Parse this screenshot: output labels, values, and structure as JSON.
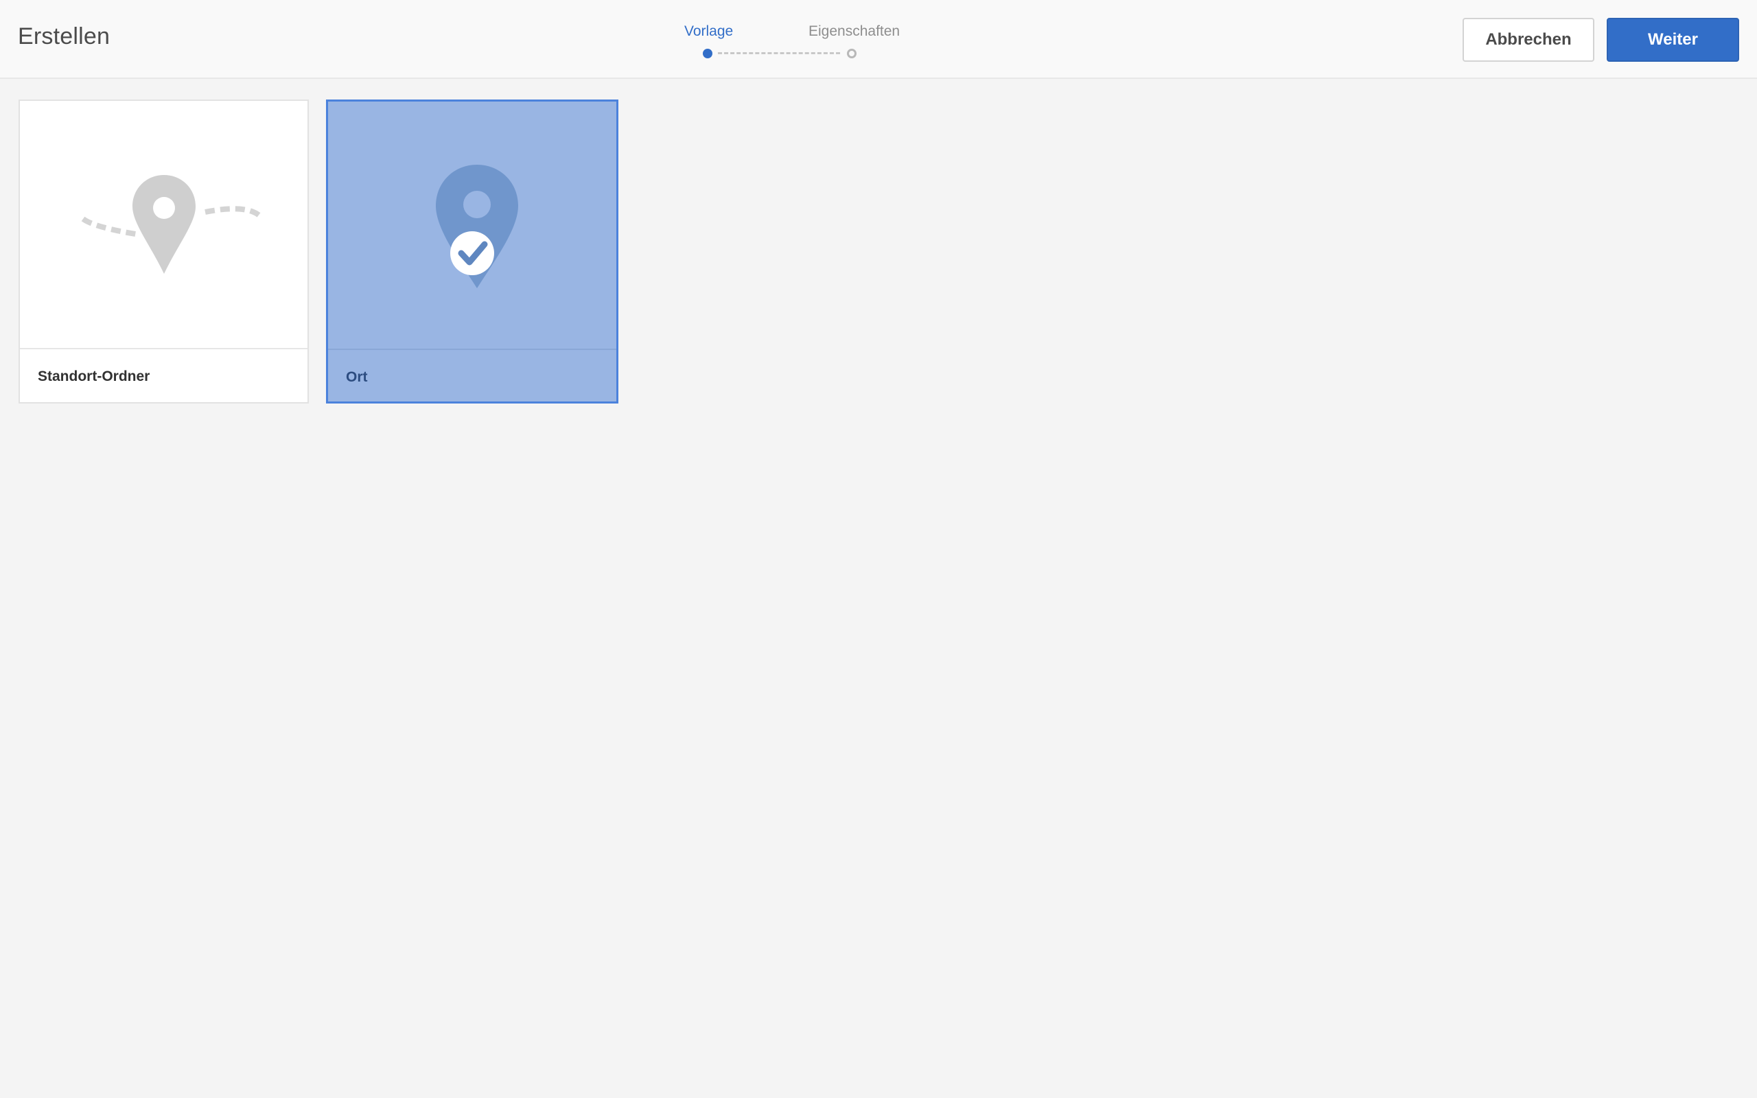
{
  "header": {
    "title": "Erstellen",
    "steps": [
      {
        "label": "Vorlage",
        "state": "active"
      },
      {
        "label": "Eigenschaften",
        "state": "inactive"
      }
    ],
    "cancel_label": "Abbrechen",
    "next_label": "Weiter"
  },
  "templates": [
    {
      "label": "Standort-Ordner",
      "icon": "location-path-icon",
      "selected": false
    },
    {
      "label": "Ort",
      "icon": "location-pin-icon",
      "selected": true
    }
  ],
  "colors": {
    "accent": "#326ec8",
    "selected_card": "#99b5e3",
    "selected_border": "#4b82dc"
  }
}
